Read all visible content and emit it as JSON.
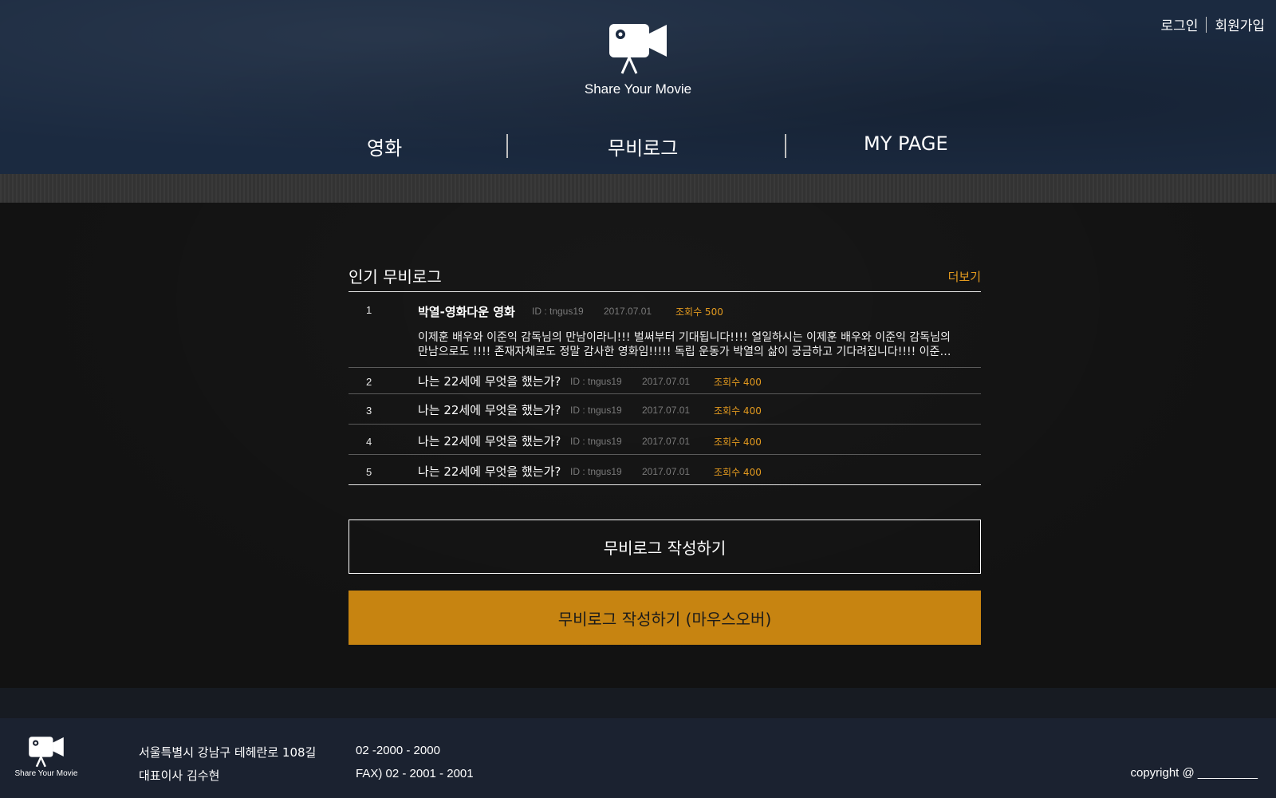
{
  "header": {
    "auth": {
      "login": "로그인",
      "signup": "회원가입"
    },
    "logo": {
      "icon": "movie-camera-icon",
      "text": "Share Your Movie"
    },
    "nav": [
      {
        "label": "영화"
      },
      {
        "label": "무비로그"
      },
      {
        "label": "MY PAGE"
      }
    ]
  },
  "main": {
    "section": {
      "title": "인기 무비로그",
      "more": "더보기"
    },
    "posts": [
      {
        "rank": "1",
        "title": "박열-영화다운 영화",
        "author": "ID : tngus19",
        "date": "2017.07.01",
        "views": "조회수 500",
        "excerpt_line1": "이제훈 배우와 이준익 감독님의 만남이라니!!! 벌써부터 기대됩니다!!!! 열일하시는 이제훈 배우와 이준익 감독님의",
        "excerpt_line2": "만남으로도 !!!! 존재자체로도 정말 감사한 영화임!!!!! 독립 운동가 박열의 삶이 궁금하고 기다려집니다!!!! 이준…"
      },
      {
        "rank": "2",
        "title": "나는 22세에 무엇을 했는가?",
        "author": "ID : tngus19",
        "date": "2017.07.01",
        "views": "조회수 400"
      },
      {
        "rank": "3",
        "title": "나는 22세에 무엇을 했는가?",
        "author": "ID : tngus19",
        "date": "2017.07.01",
        "views": "조회수 400"
      },
      {
        "rank": "4",
        "title": "나는 22세에 무엇을 했는가?",
        "author": "ID : tngus19",
        "date": "2017.07.01",
        "views": "조회수 400"
      },
      {
        "rank": "5",
        "title": "나는 22세에 무엇을 했는가?",
        "author": "ID : tngus19",
        "date": "2017.07.01",
        "views": "조회수 400"
      }
    ],
    "write_button": "무비로그 작성하기",
    "write_button_hover": "무비로그 작성하기 (마우스오버)"
  },
  "footer": {
    "logo_text": "Share Your Movie",
    "address": "서울특별시 강남구 테헤란로 108길",
    "ceo": "대표이사 김수현",
    "phone": "02 -2000 - 2000",
    "fax": "FAX) 02 - 2001 - 2001",
    "copyright": "copyright @ _________"
  },
  "colors": {
    "accent": "#e39a1f",
    "button_hover_bg": "#c78411",
    "header_bg": "#1b2a40",
    "main_bg": "#121212",
    "footer_bg": "#1b2230"
  }
}
